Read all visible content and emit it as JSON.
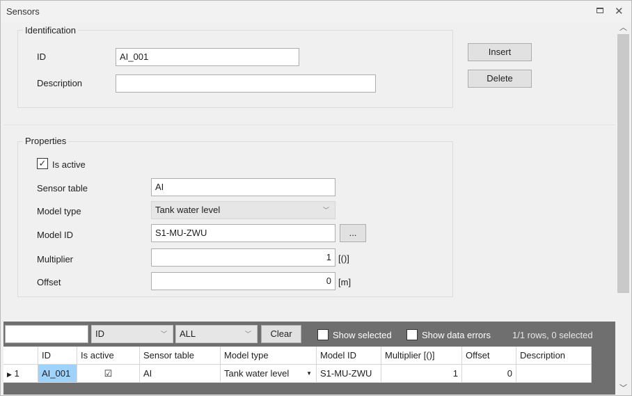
{
  "window": {
    "title": "Sensors"
  },
  "identification": {
    "caption": "Identification",
    "id_label": "ID",
    "id_value": "AI_001",
    "description_label": "Description",
    "description_value": ""
  },
  "actions": {
    "insert_label": "Insert",
    "delete_label": "Delete"
  },
  "properties": {
    "caption": "Properties",
    "is_active_label": "Is active",
    "is_active_checked": true,
    "sensor_table_label": "Sensor table",
    "sensor_table_value": "AI",
    "model_type_label": "Model type",
    "model_type_value": "Tank water level",
    "model_id_label": "Model ID",
    "model_id_value": "S1-MU-ZWU",
    "browse_label": "...",
    "multiplier_label": "Multiplier",
    "multiplier_value": "1",
    "multiplier_unit": "[()]",
    "offset_label": "Offset",
    "offset_value": "0",
    "offset_unit": "[m]"
  },
  "grid_toolbar": {
    "filter_value": "",
    "column_select": "ID",
    "scope_select": "ALL",
    "clear_label": "Clear",
    "show_selected_label": "Show selected",
    "show_errors_label": "Show data errors",
    "status": "1/1 rows, 0 selected"
  },
  "table": {
    "columns": [
      "ID",
      "Is active",
      "Sensor table",
      "Model type",
      "Model ID",
      "Multiplier [()]",
      "Offset",
      "Description"
    ],
    "rows": [
      {
        "index": "1",
        "id": "AI_001",
        "is_active": true,
        "sensor_table": "AI",
        "model_type": "Tank water level",
        "model_id": "S1-MU-ZWU",
        "multiplier": "1",
        "offset": "0",
        "description": ""
      }
    ]
  },
  "icons": {
    "restore": "restore-window-icon",
    "close": "close-icon",
    "check": "checkmark-icon",
    "chevron": "chevron-down-icon",
    "row_pointer": "row-pointer-icon"
  }
}
